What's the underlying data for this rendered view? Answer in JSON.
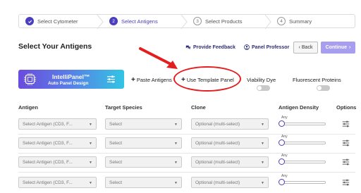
{
  "stepper": {
    "steps": [
      {
        "num": "",
        "label": "Select Cytometer",
        "state": "done"
      },
      {
        "num": "2",
        "label": "Select Antigens",
        "state": "active"
      },
      {
        "num": "3",
        "label": "Select Products",
        "state": "todo"
      },
      {
        "num": "4",
        "label": "Summary",
        "state": "todo"
      }
    ]
  },
  "header": {
    "title": "Select Your Antigens",
    "feedback_label": "Provide Feedback",
    "professor_label": "Panel Professor",
    "back_label": "Back",
    "continue_label": "Continue"
  },
  "intellipanel": {
    "title": "IntelliPanel™",
    "subtitle": "Auto Panel Design"
  },
  "actions": {
    "paste_label": "Paste Antigens",
    "template_label": "Use Template Panel",
    "viability_label": "Viability Dye",
    "fluorescent_label": "Fluorescent Proteins"
  },
  "columns": {
    "antigen": "Antigen",
    "species": "Target Species",
    "clone": "Clone",
    "density": "Antigen Density",
    "options": "Options"
  },
  "rows": [
    {
      "antigen_placeholder": "Select Antigen (CD3, F...",
      "species_placeholder": "Select",
      "clone_placeholder": "Optional (multi-select)",
      "density": "Any"
    },
    {
      "antigen_placeholder": "Select Antigen (CD3, F...",
      "species_placeholder": "Select",
      "clone_placeholder": "Optional (multi-select)",
      "density": "Any"
    },
    {
      "antigen_placeholder": "Select Antigen (CD3, F...",
      "species_placeholder": "Select",
      "clone_placeholder": "Optional (multi-select)",
      "density": "Any"
    },
    {
      "antigen_placeholder": "Select Antigen (CD3, F...",
      "species_placeholder": "Select",
      "clone_placeholder": "Optional (multi-select)",
      "density": "Any"
    }
  ],
  "colors": {
    "accent": "#4b3fbf",
    "continue_bg": "#a89ef0",
    "highlight": "#e41e1e"
  }
}
